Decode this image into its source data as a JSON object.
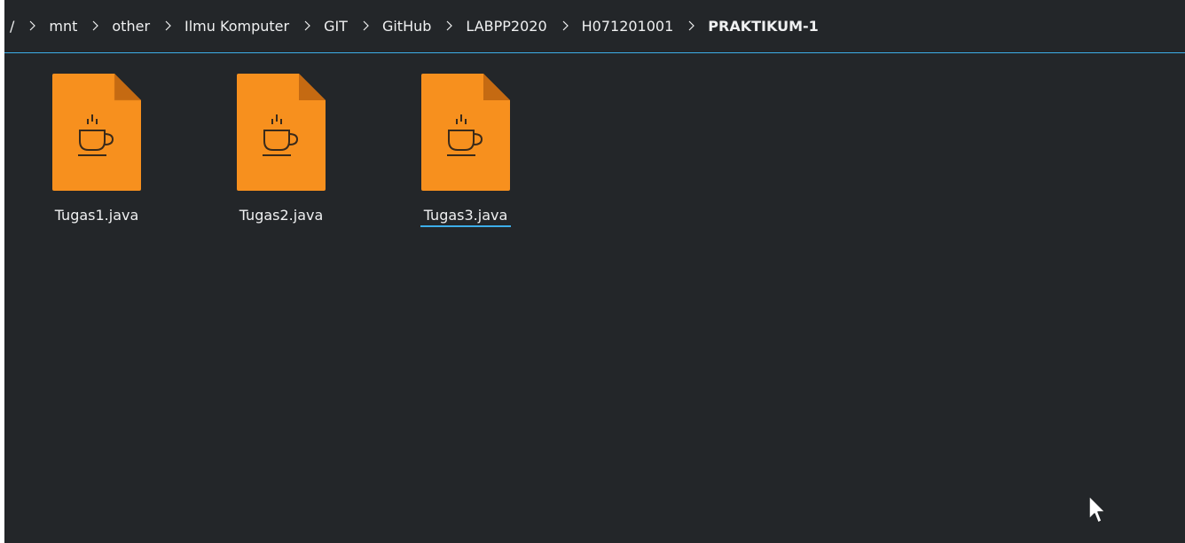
{
  "breadcrumb": {
    "root": "/",
    "items": [
      "mnt",
      "other",
      "Ilmu Komputer",
      "GIT",
      "GitHub",
      "LABPP2020",
      "H071201001"
    ],
    "current": "PRAKTIKUM-1"
  },
  "files": [
    {
      "name": "Tugas1.java",
      "icon": "java-file-icon"
    },
    {
      "name": "Tugas2.java",
      "icon": "java-file-icon"
    },
    {
      "name": "Tugas3.java",
      "icon": "java-file-icon"
    }
  ],
  "colors": {
    "background": "#232629",
    "accent": "#3daee9",
    "file_icon": "#f7901e",
    "text": "#eff0f1"
  }
}
